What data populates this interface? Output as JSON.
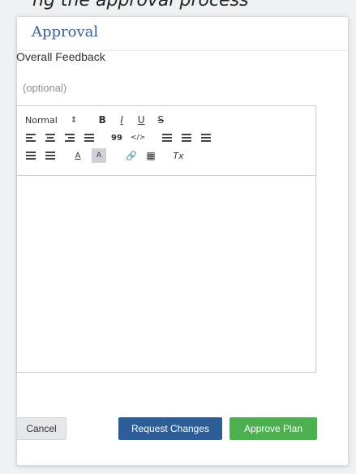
{
  "caption": "ng the approval process",
  "dialog": {
    "title": "Approval",
    "feedback_label": "Overall Feedback",
    "optional_hint": "(optional)"
  },
  "toolbar": {
    "header_select_value": "Normal",
    "header_select_arrow": "⇕",
    "bold": "B",
    "italic": "I",
    "underline": "U",
    "strike": "S",
    "blockquote": "99",
    "code": "</>",
    "color": "A",
    "background": "A",
    "link": "🔗",
    "image": "▦",
    "clean": "Tx"
  },
  "buttons": {
    "cancel": "Cancel",
    "request_changes": "Request Changes",
    "approve": "Approve Plan"
  },
  "colors": {
    "title": "#3b5f8f",
    "request_button": "#2d5d97",
    "approve_button": "#4caf50"
  }
}
